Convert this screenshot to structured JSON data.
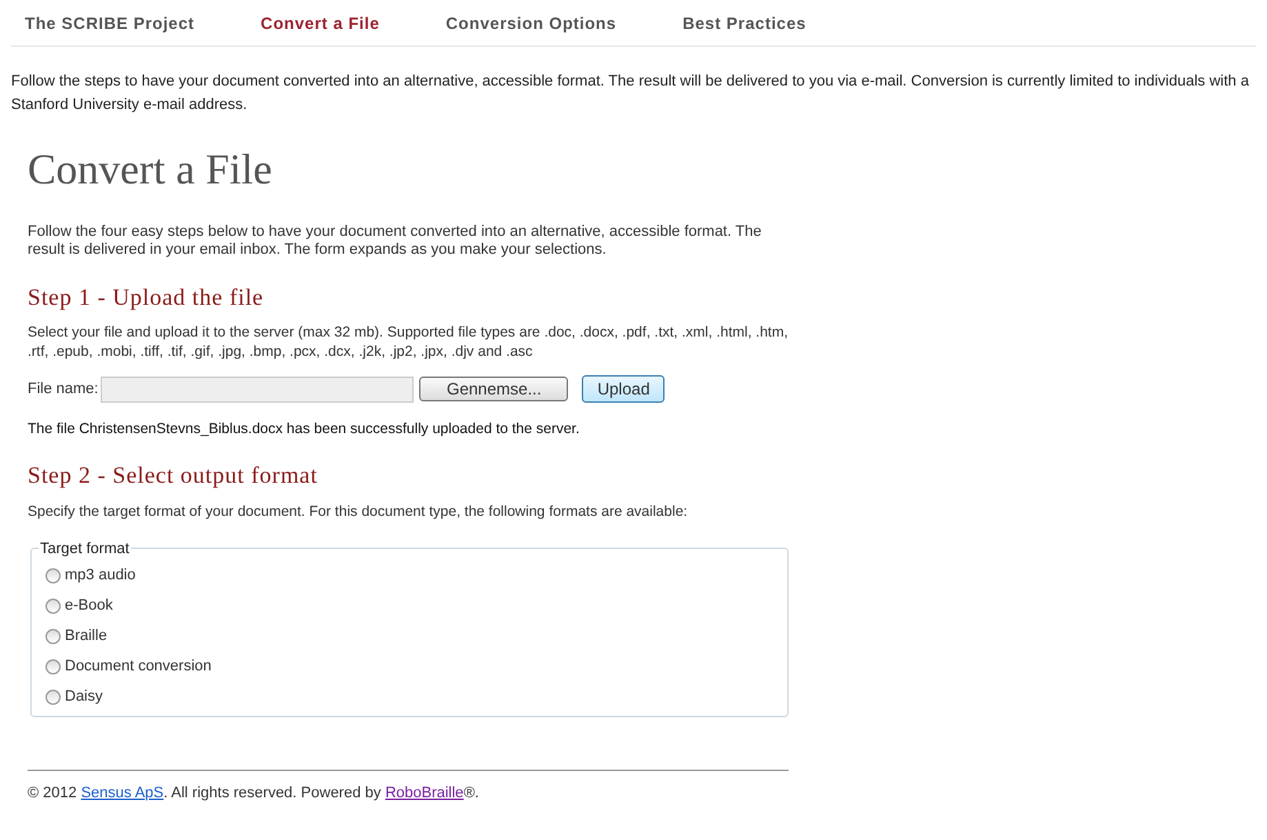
{
  "nav": [
    {
      "label": "The SCRIBE Project",
      "selected": false
    },
    {
      "label": "Convert a File",
      "selected": true
    },
    {
      "label": "Conversion Options",
      "selected": false
    },
    {
      "label": "Best Practices",
      "selected": false
    }
  ],
  "intro": "Follow the steps to have your document converted into an alternative, accessible format. The result will be delivered to you via e-mail. Conversion is currently limited to individuals with a Stanford University e-mail address.",
  "title": "Convert a File",
  "lead": "Follow the four easy steps below to have your document converted into an alternative, accessible format. The result is delivered in your email inbox. The form expands as you make your selections.",
  "step1": {
    "heading": "Step 1 - Upload the file",
    "text": "Select your file and upload it to the server (max 32 mb). Supported file types are .doc, .docx, .pdf, .txt, .xml, .html, .htm, .rtf, .epub, .mobi, .tiff, .tif, .gif, .jpg, .bmp, .pcx, .dcx, .j2k, .jp2, .jpx, .djv and .asc",
    "file_label": "File name:",
    "browse_button": "Gennemse...",
    "upload_button": "Upload",
    "status": "The file ChristensenStevns_Biblus.docx has been successfully uploaded to the server."
  },
  "step2": {
    "heading": "Step 2 - Select output format",
    "text": "Specify the target format of your document. For this document type, the following formats are available:",
    "legend": "Target format",
    "options": [
      {
        "label": "mp3 audio",
        "selected": false
      },
      {
        "label": "e-Book",
        "selected": false
      },
      {
        "label": "Braille",
        "selected": false
      },
      {
        "label": "Document conversion",
        "selected": false
      },
      {
        "label": "Daisy",
        "selected": false
      }
    ]
  },
  "footer": {
    "prefix": "© 2012 ",
    "link_1": "Sensus ApS",
    "middle": ". All rights reserved. Powered by ",
    "link_2": "RoboBraille",
    "suffix": "®."
  }
}
